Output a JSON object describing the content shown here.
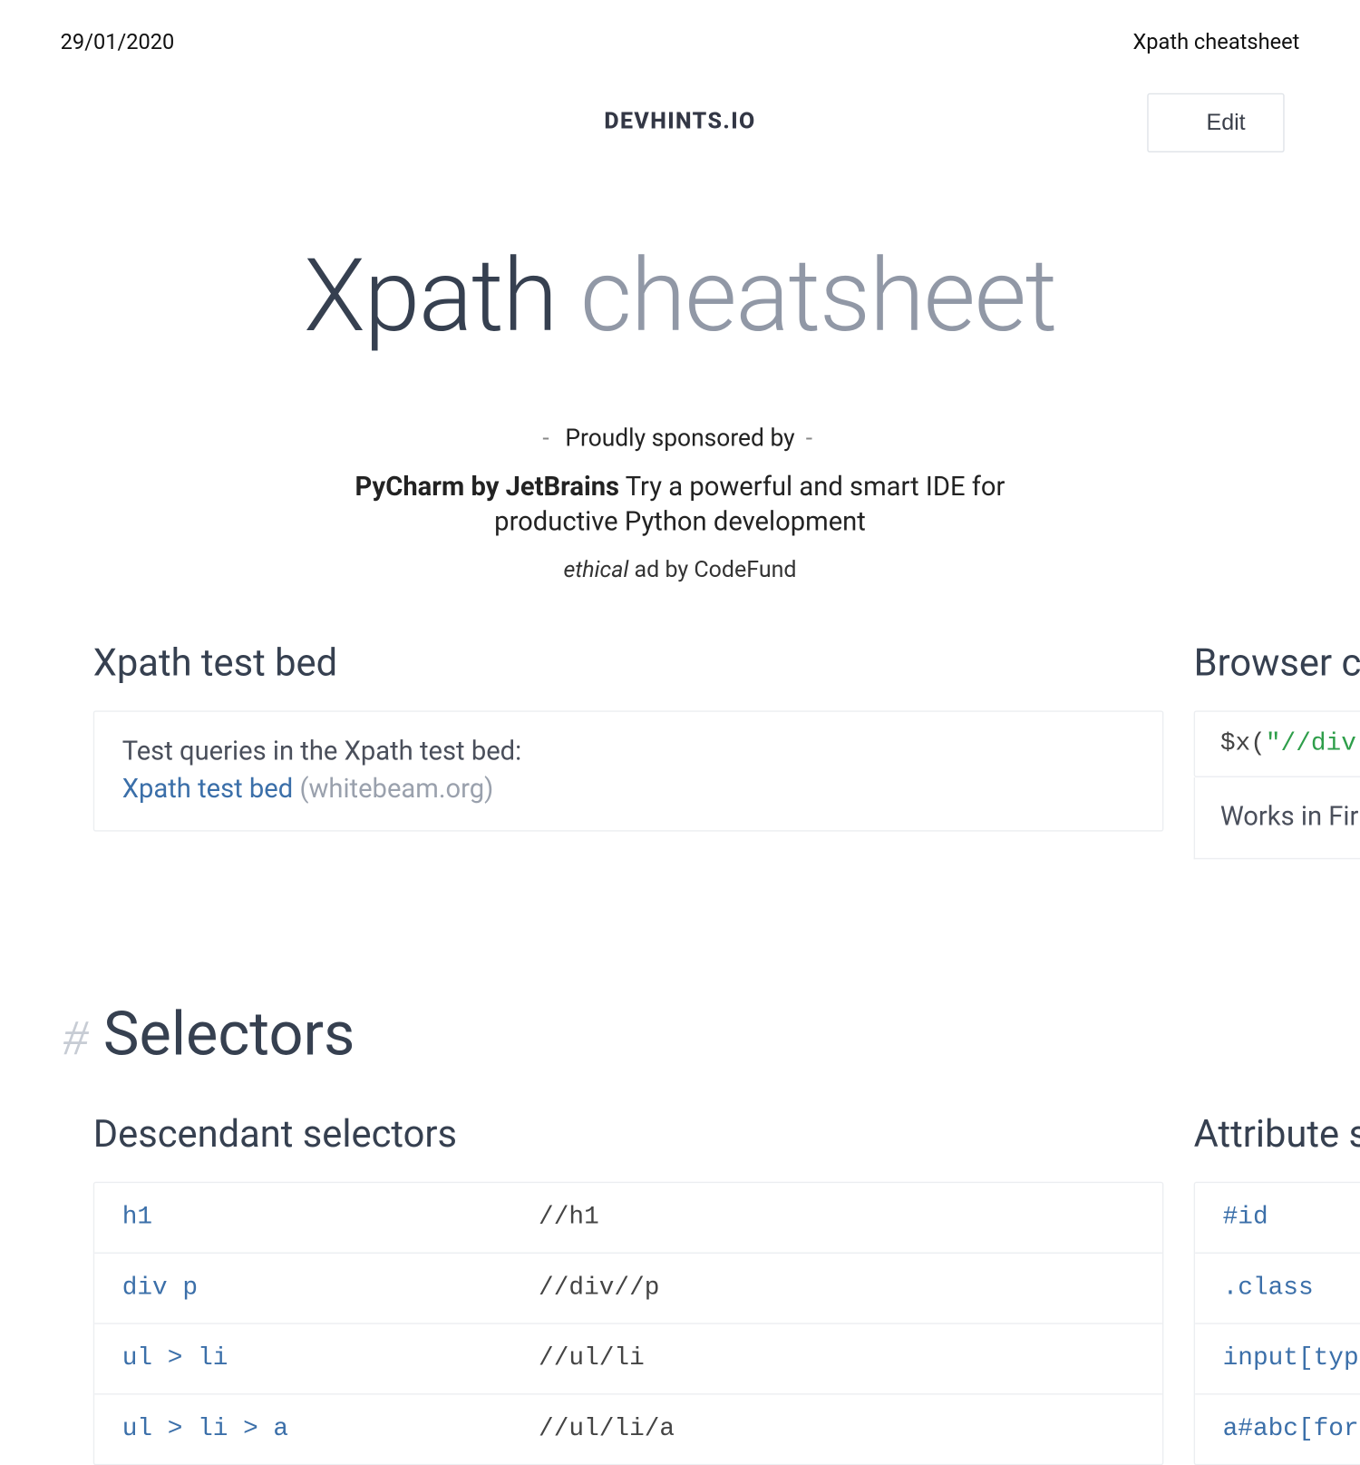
{
  "header": {
    "date": "29/01/2020",
    "doc_title": "Xpath cheatsheet"
  },
  "brand": "DEVHINTS.IO",
  "edit_label": "Edit",
  "title": {
    "main": "Xpath",
    "sub": "cheatsheet"
  },
  "sponsor": {
    "label": "Proudly sponsored by",
    "name": "PyCharm by JetBrains",
    "desc": "Try a powerful and smart IDE for productive Python development",
    "footer_em": "ethical",
    "footer_rest": " ad by CodeFund"
  },
  "testbed": {
    "title": "Xpath test bed",
    "line1": "Test queries in the Xpath test bed:",
    "link_text": "Xpath test bed",
    "link_note": "(whitebeam.org)"
  },
  "console": {
    "title": "Browser co",
    "code_fn": "$x(",
    "code_str": "\"//div",
    "note": "Works in Fir"
  },
  "selectors_hash": "#",
  "selectors_title": "Selectors",
  "descendant": {
    "title": "Descendant selectors",
    "rows": [
      {
        "css": "h1",
        "xp": "//h1"
      },
      {
        "css": "div p",
        "xp": "//div//p"
      },
      {
        "css": "ul > li",
        "xp": "//ul/li"
      },
      {
        "css": "ul > li > a",
        "xp": "//ul/li/a"
      }
    ]
  },
  "attribute": {
    "title": "Attribute s",
    "rows": [
      "#id",
      ".class",
      "input[type",
      "a#abc[for"
    ]
  }
}
